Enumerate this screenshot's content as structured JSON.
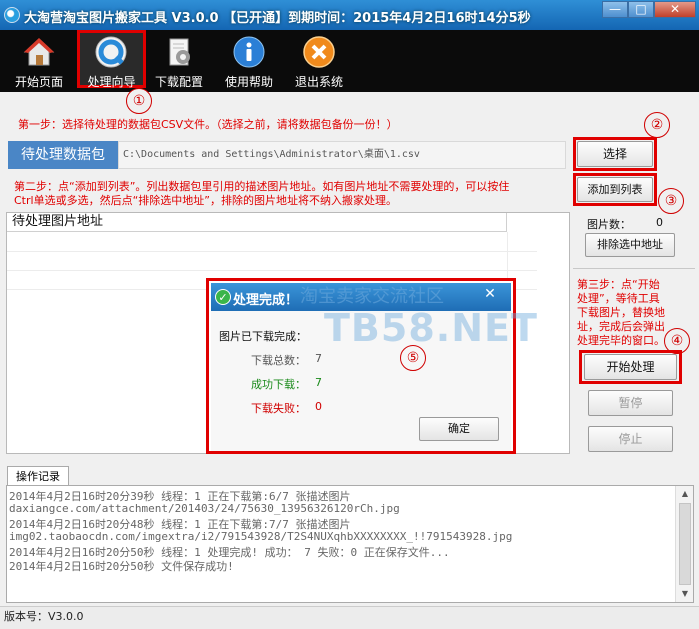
{
  "window": {
    "title": "大淘营淘宝图片搬家工具 V3.0.0 【已开通】到期时间：2015年4月2日16时14分5秒",
    "minimize": "—",
    "maximize": "□",
    "close": "✕"
  },
  "toolbar": {
    "items": [
      {
        "label": "开始页面",
        "icon": "home-icon"
      },
      {
        "label": "处理向导",
        "icon": "wizard-icon"
      },
      {
        "label": "下载配置",
        "icon": "config-icon"
      },
      {
        "label": "使用帮助",
        "icon": "info-icon"
      },
      {
        "label": "退出系统",
        "icon": "exit-icon"
      }
    ]
  },
  "step1": {
    "note": "第一步：选择待处理的数据包CSV文件。（选择之前，请将数据包备份一份！）",
    "field_label": "待处理数据包",
    "path_value": "C:\\Documents and Settings\\Administrator\\桌面\\1.csv",
    "select_button": "选择"
  },
  "step2": {
    "note_line1": "第二步：点“添加到列表”。列出数据包里引用的描述图片地址。如有图片地址不需要处理的，可以按住",
    "note_line2": "Ctrl单选或多选，然后点“排除选中地址”，排除的图片地址将不纳入搬家处理。",
    "add_button": "添加到列表"
  },
  "image_list": {
    "column_header": "待处理图片地址"
  },
  "side": {
    "count_label": "图片数：",
    "count_value": "0",
    "exclude_button": "排除选中地址",
    "step3_lines": [
      "第三步：点“开始",
      "处理”，等待工具",
      "下载图片，替换地",
      "址，完成后会弹出",
      "处理完毕的窗口。"
    ],
    "start_button": "开始处理",
    "pause_button": "暂停",
    "stop_button": "停止"
  },
  "markers": [
    "①",
    "②",
    "③",
    "④",
    "⑤"
  ],
  "dialog": {
    "title": "处理完成！",
    "close": "✕",
    "heading": "图片已下载完成：",
    "total_label": "下载总数：",
    "total_value": "7",
    "success_label": "成功下载：",
    "success_value": "7",
    "fail_label": "下载失败：",
    "fail_value": "0",
    "ok_button": "确定"
  },
  "watermark": {
    "line1": "淘宝卖家交流社区",
    "line2": "TB58.NET"
  },
  "log": {
    "tab_label": "操作记录",
    "lines": [
      "2014年4月2日16时20分39秒 线程：1  正在下载第:6/7 张描述图片",
      "daxiangce.com/attachment/201403/24/75630_13956326120rCh.jpg",
      "2014年4月2日16时20分48秒 线程：1  正在下载第:7/7 张描述图片",
      "img02.taobaocdn.com/imgextra/i2/791543928/T2S4NUXqhbXXXXXXXX_!!791543928.jpg",
      "2014年4月2日16时20分50秒 线程：1 处理完成! 成功：  7 失败：0 正在保存文件...",
      "2014年4月2日16时20分50秒 文件保存成功!"
    ]
  },
  "status": {
    "version": "版本号：V3.0.0"
  },
  "colors": {
    "title_bar": "#1f78c8",
    "toolbar_bg": "#0b0b0b",
    "annotation_red": "#e00000",
    "field_label_blue": "#4a86c6",
    "success_green": "#1a8a1a"
  }
}
